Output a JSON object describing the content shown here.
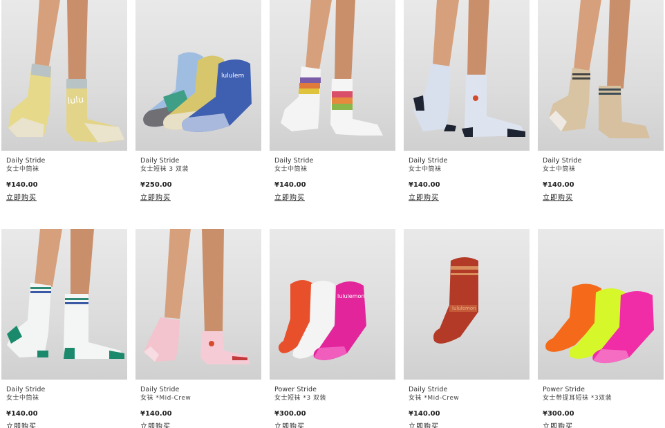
{
  "buy_label": "立即购买",
  "products": [
    {
      "collection": "Daily Stride",
      "name": "女士中筒袜",
      "price": "¥140.00",
      "image_icon": "sock-photo"
    },
    {
      "collection": "Daily Stride",
      "name": "女士短袜 3 双装",
      "price": "¥250.00",
      "image_icon": "sock-photo"
    },
    {
      "collection": "Daily Stride",
      "name": "女士中筒袜",
      "price": "¥140.00",
      "image_icon": "sock-photo"
    },
    {
      "collection": "Daily Stride",
      "name": "女士中筒袜",
      "price": "¥140.00",
      "image_icon": "sock-photo"
    },
    {
      "collection": "Daily Stride",
      "name": "女士中筒袜",
      "price": "¥140.00",
      "image_icon": "sock-photo"
    },
    {
      "collection": "Daily Stride",
      "name": "女士中筒袜",
      "price": "¥140.00",
      "image_icon": "sock-photo"
    },
    {
      "collection": "Daily Stride",
      "name": "女袜 *Mid-Crew",
      "price": "¥140.00",
      "image_icon": "sock-photo"
    },
    {
      "collection": "Power Stride",
      "name": "女士短袜 *3 双装",
      "price": "¥300.00",
      "image_icon": "sock-photo"
    },
    {
      "collection": "Daily Stride",
      "name": "女袜 *Mid-Crew",
      "price": "¥140.00",
      "image_icon": "sock-photo"
    },
    {
      "collection": "Power Stride",
      "name": "女士带提耳短袜 *3双装",
      "price": "¥300.00",
      "image_icon": "sock-photo"
    }
  ],
  "colors": {
    "text": "#222222",
    "photo_bg": "#dedede",
    "skin": "#d9a27f"
  }
}
